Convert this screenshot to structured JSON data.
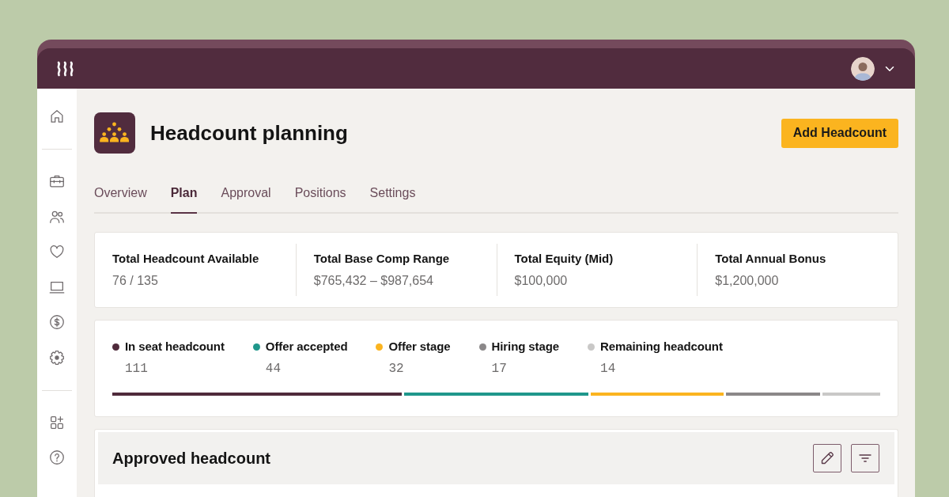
{
  "header": {
    "title": "Headcount planning",
    "action": "Add Headcount"
  },
  "tabs": [
    {
      "label": "Overview",
      "selected": false
    },
    {
      "label": "Plan",
      "selected": true
    },
    {
      "label": "Approval",
      "selected": false
    },
    {
      "label": "Positions",
      "selected": false
    },
    {
      "label": "Settings",
      "selected": false
    }
  ],
  "summary": [
    {
      "label": "Total Headcount Available",
      "value": "76 / 135"
    },
    {
      "label": "Total Base Comp Range",
      "value": "$765,432 – $987,654"
    },
    {
      "label": "Total Equity (Mid)",
      "value": "$100,000"
    },
    {
      "label": "Total Annual Bonus",
      "value": "$1,200,000"
    }
  ],
  "breakdown": [
    {
      "label": "In seat headcount",
      "count": "111",
      "color": "#4f2a3b"
    },
    {
      "label": "Offer accepted",
      "count": "44",
      "color": "#1f978b"
    },
    {
      "label": "Offer stage",
      "count": "32",
      "color": "#fbb41f"
    },
    {
      "label": "Hiring stage",
      "count": "17",
      "color": "#8b8889"
    },
    {
      "label": "Remaining headcount",
      "count": "14",
      "color": "#c9c8c7"
    }
  ],
  "approved_headcount": {
    "title": "Approved headcount"
  }
}
